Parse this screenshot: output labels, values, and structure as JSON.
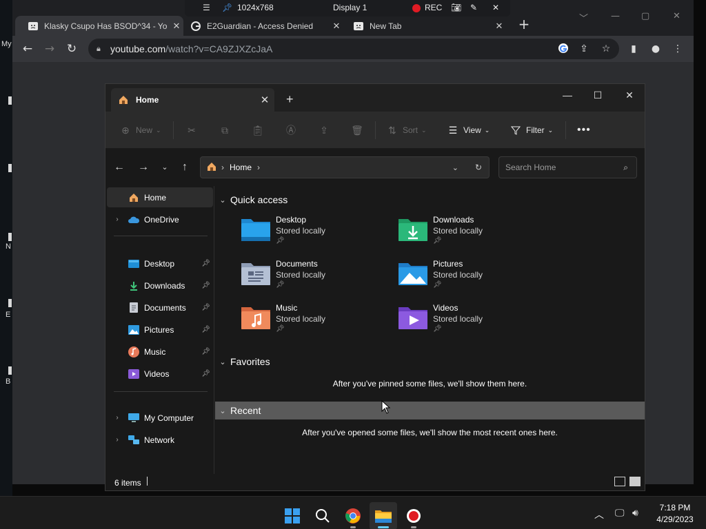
{
  "desktop": {
    "labels": [
      "My",
      "N",
      "E",
      "B"
    ]
  },
  "recorder": {
    "resolution": "1024x768",
    "display": "Display 1",
    "rec_label": "REC"
  },
  "browser": {
    "tabs": [
      {
        "title": "Klasky Csupo Has BSOD^34 - Yo",
        "close": "✕"
      },
      {
        "title": "E2Guardian - Access Denied",
        "close": "✕"
      },
      {
        "title": "New Tab",
        "close": "✕"
      }
    ],
    "url_host": "youtube.com",
    "url_path": "/watch?v=CA9ZJXZcJaA"
  },
  "explorer": {
    "tab_title": "Home",
    "commands": {
      "new": "New",
      "sort": "Sort",
      "view": "View",
      "filter": "Filter"
    },
    "address": "Home",
    "search_placeholder": "Search Home",
    "nav": {
      "home": "Home",
      "onedrive": "OneDrive",
      "pinned": [
        "Desktop",
        "Downloads",
        "Documents",
        "Pictures",
        "Music",
        "Videos"
      ],
      "my_computer": "My Computer",
      "network": "Network"
    },
    "sections": {
      "quick_access": "Quick access",
      "favorites": "Favorites",
      "recent": "Recent"
    },
    "quick_access_items": [
      {
        "name": "Desktop",
        "status": "Stored locally",
        "icon": "desktop-folder-icon"
      },
      {
        "name": "Downloads",
        "status": "Stored locally",
        "icon": "downloads-folder-icon"
      },
      {
        "name": "Documents",
        "status": "Stored locally",
        "icon": "documents-folder-icon"
      },
      {
        "name": "Pictures",
        "status": "Stored locally",
        "icon": "pictures-folder-icon"
      },
      {
        "name": "Music",
        "status": "Stored locally",
        "icon": "music-folder-icon"
      },
      {
        "name": "Videos",
        "status": "Stored locally",
        "icon": "videos-folder-icon"
      }
    ],
    "favorites_message": "After you've pinned some files, we'll show them here.",
    "recent_message": "After you've opened some files, we'll show the most recent ones here.",
    "status": "6 items"
  },
  "taskbar": {
    "time": "7:18 PM",
    "date": "4/29/2023"
  }
}
